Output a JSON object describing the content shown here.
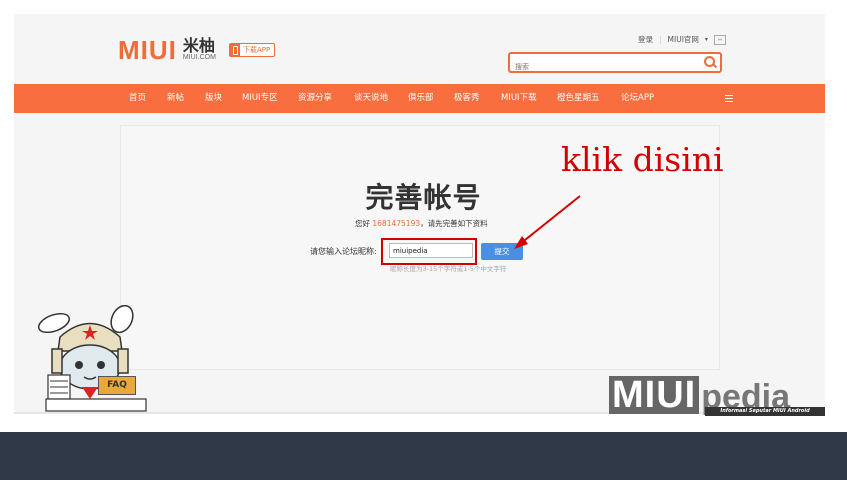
{
  "header": {
    "logo_text": "MIUI",
    "logo_cn": "米柚",
    "logo_domain": "MIUI.COM",
    "app_button": "下载APP",
    "login": "登录",
    "official": "MIUI官网",
    "search_placeholder": "搜索"
  },
  "nav": {
    "items": [
      "首页",
      "新帖",
      "版块",
      "MIUI专区",
      "资源分享",
      "谈天说地",
      "俱乐部",
      "极客秀",
      "MIUI下载",
      "橙色星期五",
      "论坛APP"
    ]
  },
  "main": {
    "title": "完善帐号",
    "welcome_prefix": "您好",
    "user_id": "1681475193",
    "welcome_suffix": "，请先完善如下资料",
    "nickname_label": "请您输入论坛昵称:",
    "nickname_value": "miuipedia",
    "submit_label": "提交",
    "hint": "昵称长度为3-15个字符或1-5个中文字符"
  },
  "annotation": {
    "text": "klik disini"
  },
  "mascot": {
    "faq_label": "FAQ"
  },
  "watermark": {
    "miui": "MIUI",
    "pedia": "pedia",
    "tagline": "Informasi Seputar MIUI Android"
  },
  "colors": {
    "accent": "#f86e3f",
    "annotation_red": "#d40000",
    "submit_blue": "#4a90e2",
    "footer": "#2f3948"
  }
}
